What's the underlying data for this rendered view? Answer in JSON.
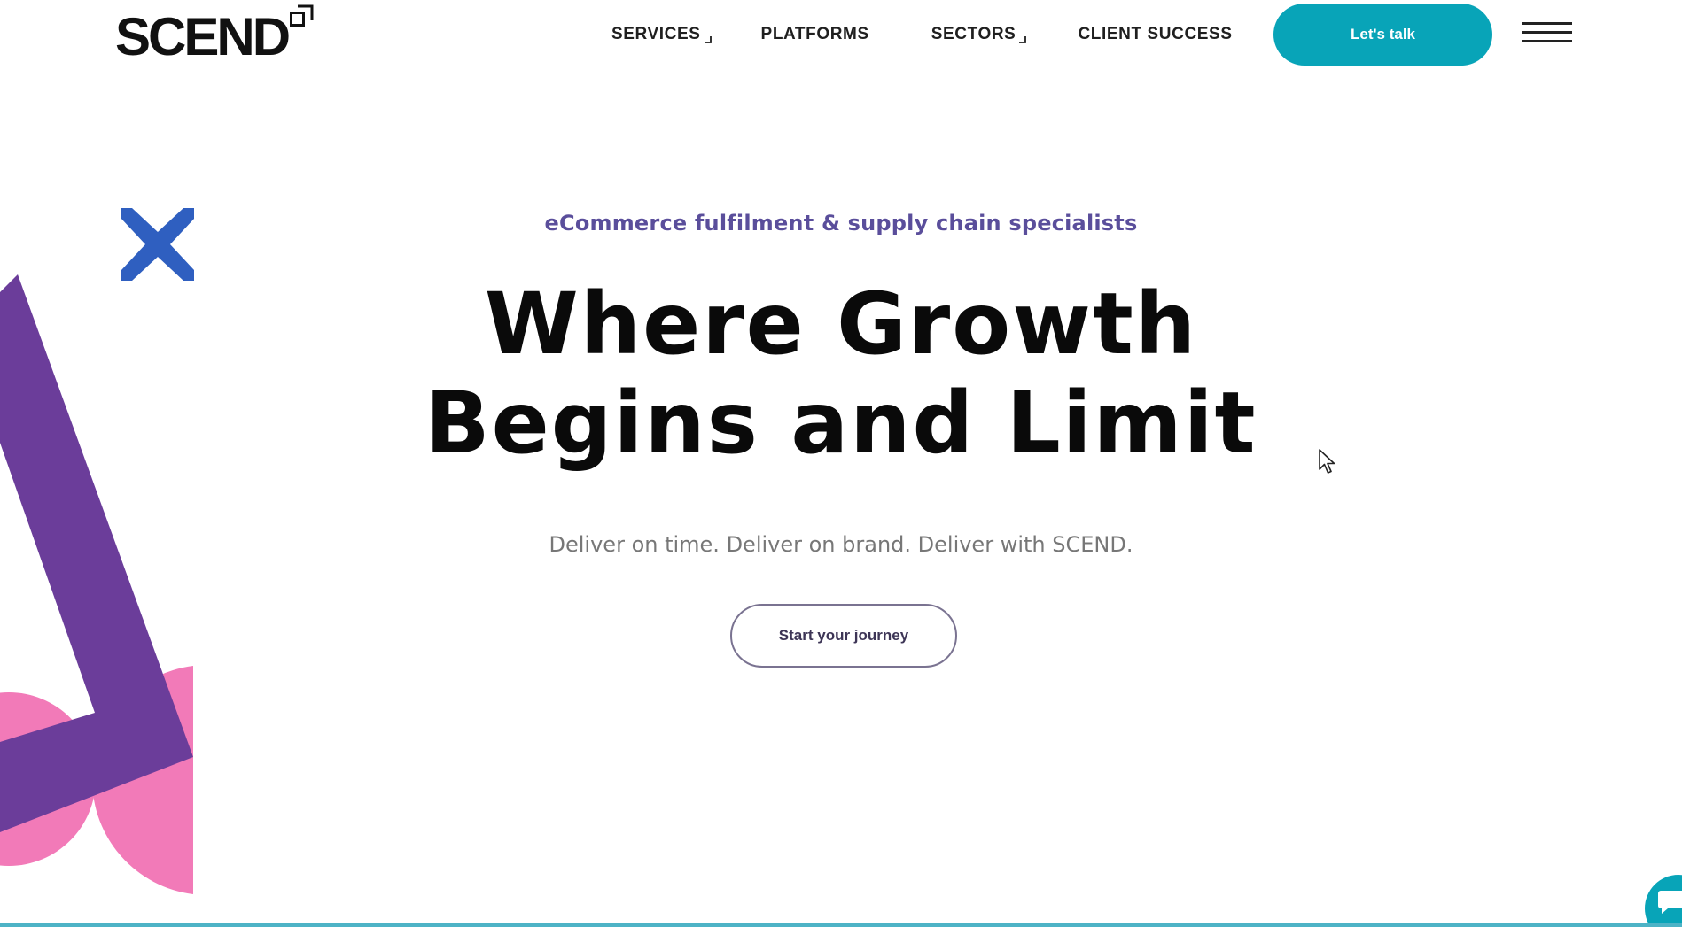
{
  "header": {
    "logo_text": "SCEND",
    "nav": [
      {
        "label": "SERVICES",
        "has_dropdown": true
      },
      {
        "label": "PLATFORMS",
        "has_dropdown": false
      },
      {
        "label": "SECTORS",
        "has_dropdown": true
      },
      {
        "label": "CLIENT SUCCESS",
        "has_dropdown": false
      }
    ],
    "cta_label": "Let's talk",
    "menu_icon": "hamburger-icon"
  },
  "hero": {
    "eyebrow": "eCommerce fulfilment & supply chain specialists",
    "title_line1": "Where Growth",
    "title_line2": "Begins and Limit",
    "subtitle": "Deliver on time. Deliver on brand. Deliver with SCEND.",
    "button_label": "Start your journey"
  },
  "decor": {
    "cross_icon": "x-cross-icon",
    "shapes": [
      "purple-bracket",
      "pink-circle"
    ]
  },
  "chat": {
    "icon": "chat-icon"
  },
  "colors": {
    "accent_teal": "#08a4b8",
    "eyebrow_purple": "#5a4e9b",
    "decor_purple": "#6b3d9a",
    "decor_pink": "#f27ab8",
    "decor_blue": "#2f5fc0",
    "bottom_line": "#4db3c6"
  }
}
